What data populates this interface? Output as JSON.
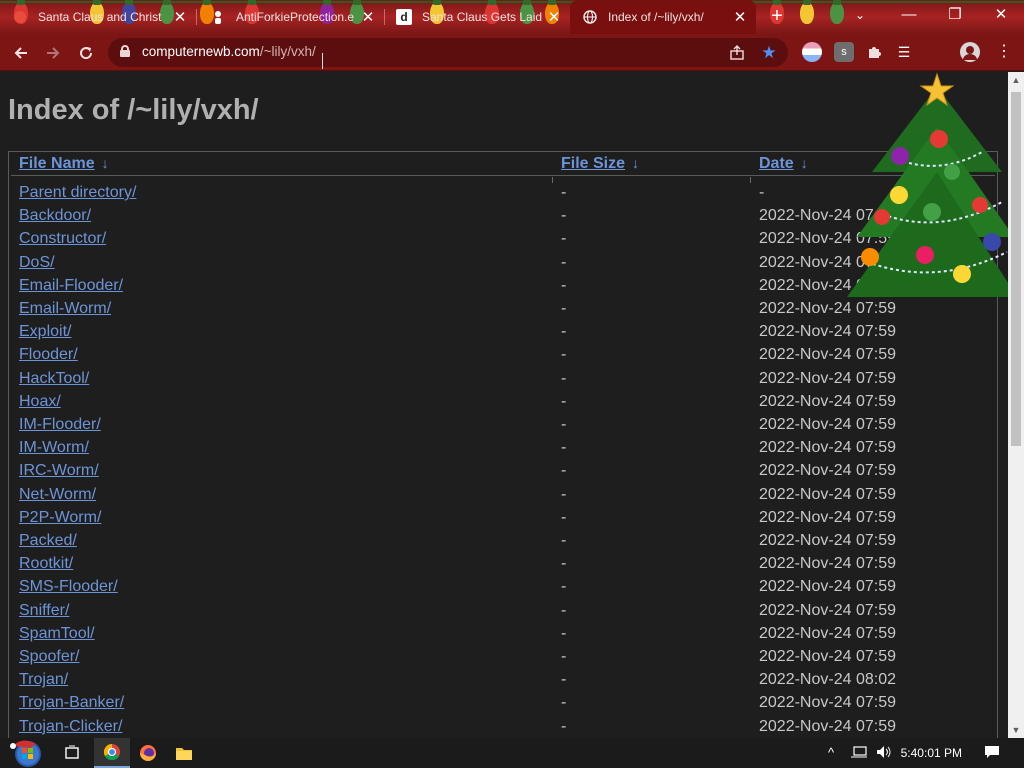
{
  "tabs": [
    {
      "title": "Santa Claus and Christ",
      "favicon": "red-circle-icon"
    },
    {
      "title": "AntiForkieProtection.e",
      "favicon": "person-icon"
    },
    {
      "title": "Santa Claus Gets Laid",
      "favicon": "d-letter-icon",
      "favicon_text": "d"
    },
    {
      "title": "Index of /~lily/vxh/",
      "favicon": "globe-icon",
      "active": true
    }
  ],
  "toolbar": {
    "url_host": "computernewb.com",
    "url_path": "/~lily/vxh/",
    "extension_badge": "s"
  },
  "page": {
    "title": "Index of /~lily/vxh/",
    "columns": {
      "name": "File Name",
      "size": "File Size",
      "date": "Date",
      "sort_arrow": "↓"
    },
    "rows": [
      {
        "name": "Parent directory/",
        "size": "-",
        "date": "-"
      },
      {
        "name": "Backdoor/",
        "size": "-",
        "date": "2022-Nov-24 07:59"
      },
      {
        "name": "Constructor/",
        "size": "-",
        "date": "2022-Nov-24 07:59"
      },
      {
        "name": "DoS/",
        "size": "-",
        "date": "2022-Nov-24 07:59"
      },
      {
        "name": "Email-Flooder/",
        "size": "-",
        "date": "2022-Nov-24 07:59"
      },
      {
        "name": "Email-Worm/",
        "size": "-",
        "date": "2022-Nov-24 07:59"
      },
      {
        "name": "Exploit/",
        "size": "-",
        "date": "2022-Nov-24 07:59"
      },
      {
        "name": "Flooder/",
        "size": "-",
        "date": "2022-Nov-24 07:59"
      },
      {
        "name": "HackTool/",
        "size": "-",
        "date": "2022-Nov-24 07:59"
      },
      {
        "name": "Hoax/",
        "size": "-",
        "date": "2022-Nov-24 07:59"
      },
      {
        "name": "IM-Flooder/",
        "size": "-",
        "date": "2022-Nov-24 07:59"
      },
      {
        "name": "IM-Worm/",
        "size": "-",
        "date": "2022-Nov-24 07:59"
      },
      {
        "name": "IRC-Worm/",
        "size": "-",
        "date": "2022-Nov-24 07:59"
      },
      {
        "name": "Net-Worm/",
        "size": "-",
        "date": "2022-Nov-24 07:59"
      },
      {
        "name": "P2P-Worm/",
        "size": "-",
        "date": "2022-Nov-24 07:59"
      },
      {
        "name": "Packed/",
        "size": "-",
        "date": "2022-Nov-24 07:59"
      },
      {
        "name": "Rootkit/",
        "size": "-",
        "date": "2022-Nov-24 07:59"
      },
      {
        "name": "SMS-Flooder/",
        "size": "-",
        "date": "2022-Nov-24 07:59"
      },
      {
        "name": "Sniffer/",
        "size": "-",
        "date": "2022-Nov-24 07:59"
      },
      {
        "name": "SpamTool/",
        "size": "-",
        "date": "2022-Nov-24 07:59"
      },
      {
        "name": "Spoofer/",
        "size": "-",
        "date": "2022-Nov-24 07:59"
      },
      {
        "name": "Trojan/",
        "size": "-",
        "date": "2022-Nov-24 08:02"
      },
      {
        "name": "Trojan-Banker/",
        "size": "-",
        "date": "2022-Nov-24 07:59"
      },
      {
        "name": "Trojan-Clicker/",
        "size": "-",
        "date": "2022-Nov-24 07:59"
      }
    ]
  },
  "taskbar": {
    "clock": "5:40:01 PM",
    "apps": [
      "chrome-icon",
      "firefox-icon",
      "file-explorer-icon"
    ]
  },
  "colors": {
    "tabstrip": "#a82222",
    "toolbar": "#7e1515",
    "link": "#6e94d8",
    "page_bg": "#1e1e1e"
  }
}
